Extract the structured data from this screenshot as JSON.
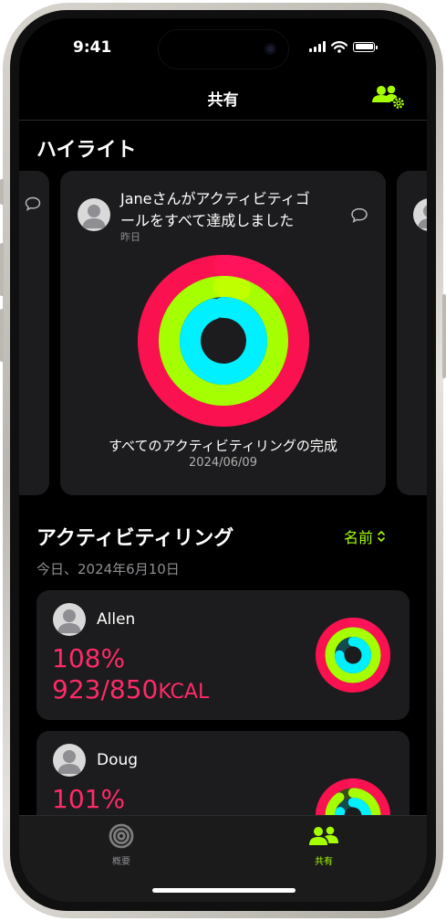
{
  "status": {
    "time": "9:41"
  },
  "header": {
    "title": "共有"
  },
  "highlights": {
    "title": "ハイライト",
    "card": {
      "message_line1": "Janeさんがアクティビティゴ",
      "message_line2": "ールをすべて達成しました",
      "time": "昨日",
      "caption": "すべてのアクティビティリングの完成",
      "date": "2024/06/09"
    }
  },
  "rings": {
    "title": "アクティビティリング",
    "sort_label": "名前",
    "date": "今日、2024年6月10日",
    "people": [
      {
        "name": "Allen",
        "percent": "108%",
        "kcal": "923/850",
        "unit": "KCAL",
        "move": 1.08,
        "exercise": 1.0,
        "stand": 0.75
      },
      {
        "name": "Doug",
        "percent": "101%",
        "move": 1.01,
        "exercise": 0.9,
        "stand": 0.8
      }
    ]
  },
  "tabs": [
    {
      "label": "概要",
      "active": false,
      "icon": "summary-icon"
    },
    {
      "label": "共有",
      "active": true,
      "icon": "sharing-icon"
    }
  ],
  "colors": {
    "move": "#fa114f",
    "exercise": "#a6ff00",
    "stand": "#00f0ff",
    "accent": "#a6ff00",
    "move_text": "#ff2a68"
  }
}
